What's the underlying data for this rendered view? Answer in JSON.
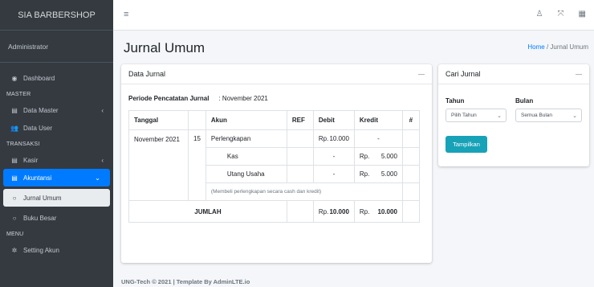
{
  "brand": "SIA BARBERSHOP",
  "user": "Administrator",
  "sidebar": {
    "dashboard": "Dashboard",
    "header_master": "MASTER",
    "data_master": "Data Master",
    "data_user": "Data User",
    "header_transaksi": "TRANSAKSI",
    "kasir": "Kasir",
    "akuntansi": "Akuntansi",
    "jurnal_umum": "Jurnal Umum",
    "buku_besar": "Buku Besar",
    "header_menu": "MENU",
    "setting_akun": "Setting Akun"
  },
  "page": {
    "title": "Jurnal Umum",
    "crumb_home": "Home",
    "crumb_sep": " / ",
    "crumb_current": "Jurnal Umum"
  },
  "data_card": {
    "title": "Data Jurnal",
    "periode_label": "Periode Pencatatan Jurnal",
    "periode_value": ": November  2021",
    "headers": {
      "tanggal": "Tanggal",
      "akun": "Akun",
      "ref": "REF",
      "debit": "Debit",
      "kredit": "Kredit",
      "hash": "#"
    },
    "date_month": "November 2021",
    "date_day": "15",
    "rows": [
      {
        "akun": "Perlengkapan",
        "debit_rp": "Rp.",
        "debit": "10.000",
        "kredit_rp": "",
        "kredit": "-"
      },
      {
        "akun": "Kas",
        "debit_rp": "",
        "debit": "-",
        "kredit_rp": "Rp.",
        "kredit": "5.000"
      },
      {
        "akun": "Utang Usaha",
        "debit_rp": "",
        "debit": "-",
        "kredit_rp": "Rp.",
        "kredit": "5.000"
      }
    ],
    "note": "(Membeli perlengkapan secara cash dan kredit)",
    "total_label": "JUMLAH",
    "total_debit_rp": "Rp.",
    "total_debit": "10.000",
    "total_kredit_rp": "Rp.",
    "total_kredit": "10.000"
  },
  "search_card": {
    "title": "Cari Jurnal",
    "tahun_label": "Tahun",
    "tahun_value": "Pilih Tahun",
    "bulan_label": "Bulan",
    "bulan_value": "Semua Bulan",
    "button": "Tampilkan"
  },
  "footer": "UNG-Tech © 2021 | Template By AdminLTE.io"
}
